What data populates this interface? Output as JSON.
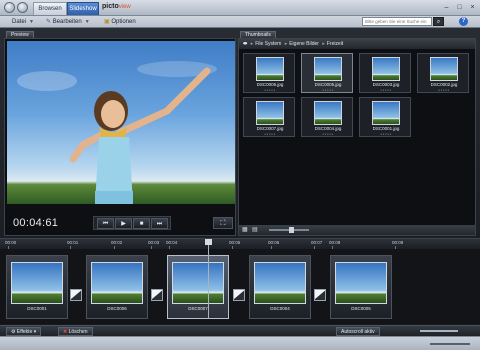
{
  "tabs": [
    {
      "label": "Browsen",
      "active": false
    },
    {
      "label": "Slideshow",
      "active": true
    }
  ],
  "app": {
    "name": "picto",
    "suffix": "view"
  },
  "menu": {
    "datei": "Datei",
    "bearbeiten": "Bearbeiten",
    "optionen": "Optionen"
  },
  "search": {
    "placeholder": "Bitte geben Sie eine Suche ein"
  },
  "help_label": "?",
  "preview": {
    "tab_label": "Preview",
    "timecode": "00:04:61"
  },
  "thumbnails": {
    "tab_label": "Thumbnails",
    "breadcrumb": [
      "File System",
      "Eigene Bilder",
      "Freizeit"
    ],
    "items": [
      {
        "name": "DSC0006.jpg",
        "selected": false
      },
      {
        "name": "DSC0005.jpg",
        "selected": true
      },
      {
        "name": "DSC0003.jpg",
        "selected": false
      },
      {
        "name": "DSC0002.jpg",
        "selected": false
      },
      {
        "name": "DSC0007.jpg",
        "selected": false
      },
      {
        "name": "DSC0004.jpg",
        "selected": false
      },
      {
        "name": "DSC0001.jpg",
        "selected": false
      }
    ]
  },
  "timeline": {
    "ruler": [
      "00:00",
      "00:01",
      "00:02",
      "00:03",
      "00:04",
      "00:05",
      "00:06",
      "00:07",
      "00:08",
      "00:09"
    ],
    "clips": [
      {
        "name": "DSC0001"
      },
      {
        "name": "DSC0006"
      },
      {
        "name": "DSC0007",
        "selected": true
      },
      {
        "name": "DSC0004"
      },
      {
        "name": "DSC0005"
      }
    ]
  },
  "bottom": {
    "effects_label": "Effekte",
    "delete_label": "Löschen",
    "autoscroll_label": "Autoscroll aktiv"
  },
  "colors": {
    "accent": "#2f5fa8",
    "panel_bg": "#0d0f12"
  }
}
